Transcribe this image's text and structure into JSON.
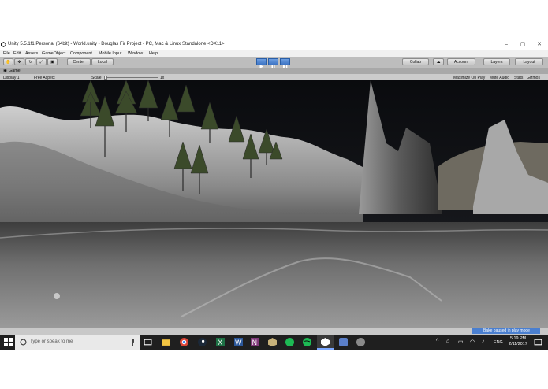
{
  "window": {
    "title": "Unity 5.5.1f1 Personal (64bit) - World.unity - Douglas Fir Project - PC, Mac & Linux Standalone <DX11>",
    "controls": [
      "–",
      "▢",
      "✕"
    ]
  },
  "menu": [
    "File",
    "Edit",
    "Assets",
    "GameObject",
    "Component",
    "Mobile Input",
    "Window",
    "Help"
  ],
  "toolbar": {
    "pivot": "Center",
    "space": "Local",
    "collab": "Collab",
    "account": "Account",
    "layers": "Layers",
    "layout": "Layout"
  },
  "game_tab": {
    "label": "Game",
    "display": "Display 1",
    "aspect": "Free Aspect",
    "scale_label": "Scale",
    "scale_value": "1x",
    "maximize": "Maximize On Play",
    "mute": "Mute Audio",
    "stats": "Stats",
    "gizmos": "Gizmos"
  },
  "status": {
    "message": "Bake paused in play mode"
  },
  "taskbar": {
    "search_placeholder": "Type or speak to me",
    "lang": "ENG",
    "time": "5:19 PM",
    "date": "2/11/2017"
  },
  "colors": {
    "play_active": "#3d74c4",
    "taskbar": "#1f1f1f",
    "status_highlight": "#4a7fd0"
  },
  "icons": [
    "unity-logo-icon",
    "hand-tool-icon",
    "move-tool-icon",
    "rotate-tool-icon",
    "scale-tool-icon",
    "rect-tool-icon",
    "play-icon",
    "pause-icon",
    "step-icon",
    "cloud-icon",
    "windows-start-icon",
    "cortana-icon",
    "mic-icon",
    "task-view-icon",
    "file-explorer-icon",
    "chrome-icon",
    "steam-icon",
    "excel-icon",
    "word-icon",
    "onenote-icon",
    "spotify-icon",
    "unity-taskbar-icon",
    "notification-icon"
  ]
}
